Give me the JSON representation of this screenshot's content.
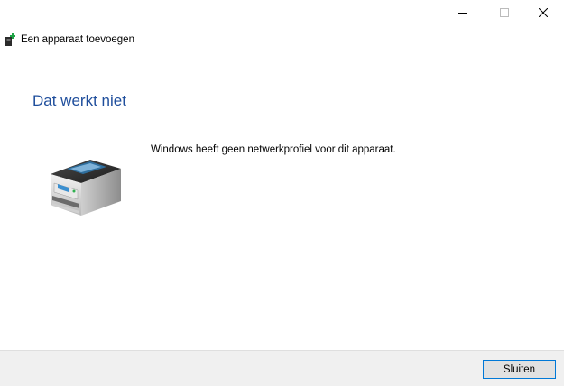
{
  "window": {
    "controls": {
      "minimize_icon": "minimize-icon",
      "maximize_icon": "maximize-icon",
      "close_icon": "close-icon"
    }
  },
  "header": {
    "title": "Een apparaat toevoegen",
    "icon": "add-device-icon"
  },
  "content": {
    "heading": "Dat werkt niet",
    "message": "Windows heeft geen netwerkprofiel voor dit apparaat.",
    "illustration": "printer-icon"
  },
  "footer": {
    "close_label": "Sluiten"
  },
  "colors": {
    "heading": "#1f4e9c",
    "footer_bg": "#f0f0f0",
    "button_border": "#0078d7"
  }
}
